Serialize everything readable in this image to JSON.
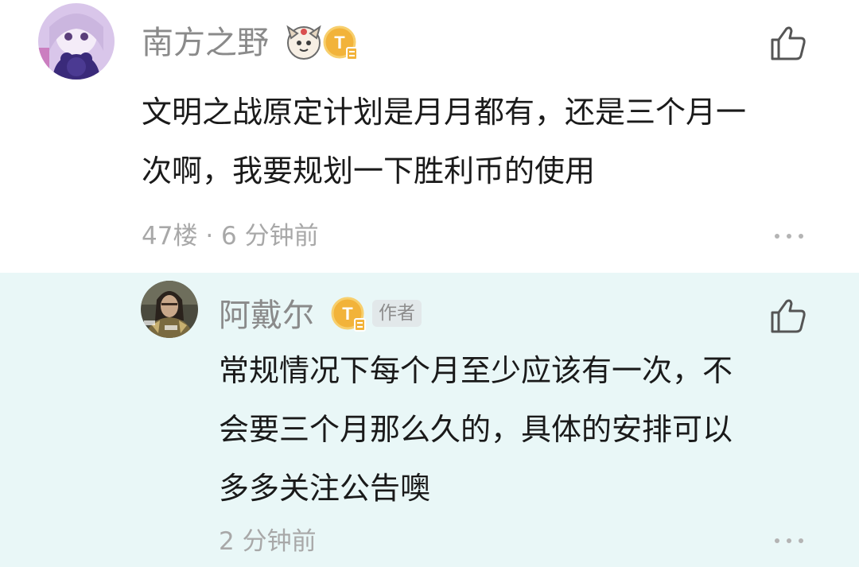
{
  "comment": {
    "username": "南方之野",
    "text_line1": "文明之战原定计划是月月都有，还是三个月一",
    "text_line2": "次啊，我要规划一下胜利币的使用",
    "floor": "47楼",
    "separator": "·",
    "time": "6 分钟前",
    "badge_letter": "T"
  },
  "reply": {
    "username": "阿戴尔",
    "author_tag": "作者",
    "text_line1": "常规情况下每个月至少应该有一次，不",
    "text_line2": "会要三个月那么久的，具体的安排可以",
    "text_line3": "多多关注公告噢",
    "time": "2 分钟前",
    "badge_letter": "T"
  },
  "icons": {
    "like": "thumbs-up-icon",
    "more": "more-dots-icon",
    "badge": "coin-badge-icon",
    "sticker": "character-sticker-icon"
  },
  "colors": {
    "reply_background": "#e9f7f7",
    "badge_gold": "#f2b33a",
    "name_gray": "#8a8a8a"
  }
}
